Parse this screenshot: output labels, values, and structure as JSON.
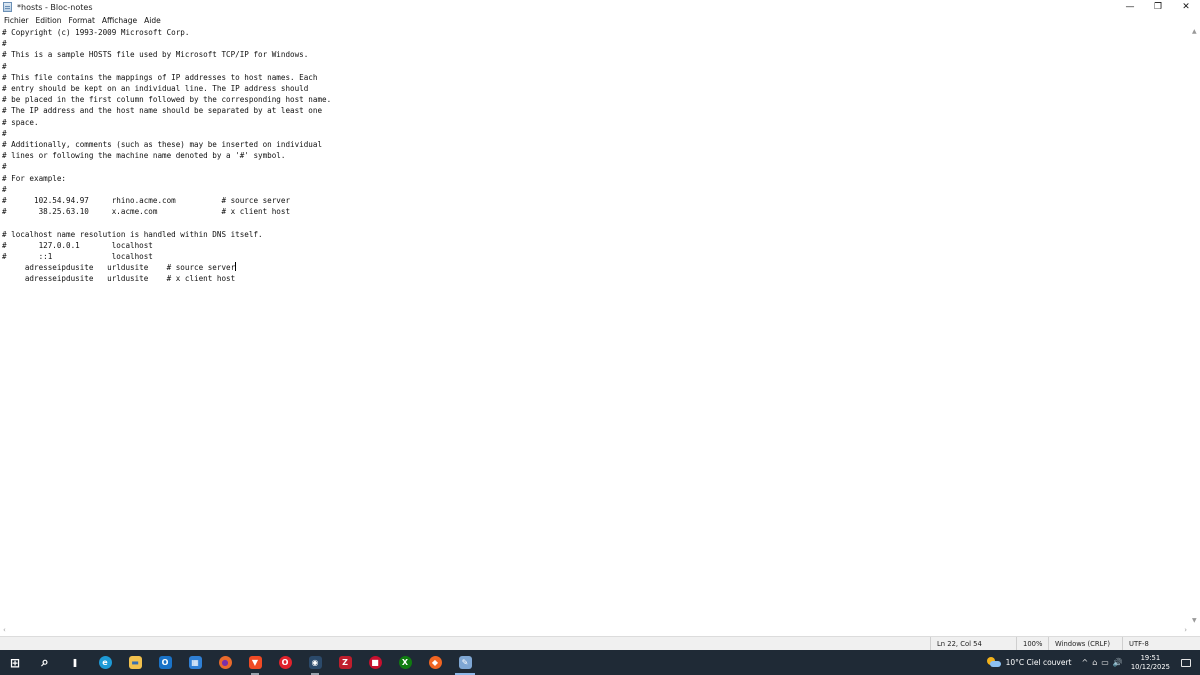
{
  "window": {
    "title": "*hosts - Bloc-notes",
    "minimize": "—",
    "restore": "❐",
    "close": "✕"
  },
  "menu": {
    "items": [
      "Fichier",
      "Edition",
      "Format",
      "Affichage",
      "Aide"
    ]
  },
  "editor": {
    "text_before_caret": "# Copyright (c) 1993-2009 Microsoft Corp.\n#\n# This is a sample HOSTS file used by Microsoft TCP/IP for Windows.\n#\n# This file contains the mappings of IP addresses to host names. Each\n# entry should be kept on an individual line. The IP address should\n# be placed in the first column followed by the corresponding host name.\n# The IP address and the host name should be separated by at least one\n# space.\n#\n# Additionally, comments (such as these) may be inserted on individual\n# lines or following the machine name denoted by a '#' symbol.\n#\n# For example:\n#\n#      102.54.94.97     rhino.acme.com          # source server\n#       38.25.63.10     x.acme.com              # x client host\n\n# localhost name resolution is handled within DNS itself.\n#\t127.0.0.1       localhost\n#\t::1             localhost\n     adresseipdusite   urldusite    # source server",
    "text_after_caret": "\n     adresseipdusite   urldusite    # x client host"
  },
  "statusbar": {
    "position": "Ln 22, Col 54",
    "zoom": "100%",
    "line_ending": "Windows (CRLF)",
    "encoding": "UTF-8"
  },
  "taskbar": {
    "apps": [
      {
        "name": "windows-start-icon",
        "glyph": "⊞",
        "color": "#ffffff"
      },
      {
        "name": "search-icon",
        "glyph": "⌕",
        "color": "#ffffff"
      },
      {
        "name": "task-view-icon",
        "glyph": "❚",
        "color": "#ffffff"
      },
      {
        "name": "edge-icon",
        "glyph": "e",
        "color": "#1e9ad6"
      },
      {
        "name": "file-explorer-icon",
        "glyph": "▬",
        "color": "#f2c14e"
      },
      {
        "name": "outlook-icon",
        "glyph": "O",
        "color": "#1a73c8"
      },
      {
        "name": "store-icon",
        "glyph": "▦",
        "color": "#2f80d6"
      },
      {
        "name": "firefox-icon",
        "glyph": "●",
        "color": "#e96a2c"
      },
      {
        "name": "brave-icon",
        "glyph": "▼",
        "color": "#f04a24"
      },
      {
        "name": "opera-icon",
        "glyph": "O",
        "color": "#e1232c"
      },
      {
        "name": "steam-icon",
        "glyph": "◉",
        "color": "#2b4a6b"
      },
      {
        "name": "filezilla-icon",
        "glyph": "Z",
        "color": "#bf1e2d"
      },
      {
        "name": "app-red-icon",
        "glyph": "■",
        "color": "#c8102e"
      },
      {
        "name": "xbox-icon",
        "glyph": "X",
        "color": "#107c10"
      },
      {
        "name": "origin-icon",
        "glyph": "◆",
        "color": "#f26522"
      },
      {
        "name": "notepad-icon",
        "glyph": "✎",
        "color": "#7fa7d4"
      }
    ],
    "weather": "10°C  Ciel couvert",
    "time": "19:51",
    "date": "10/12/2025",
    "tray_icons": [
      "^",
      "⌂",
      "▭",
      "🔊"
    ]
  }
}
